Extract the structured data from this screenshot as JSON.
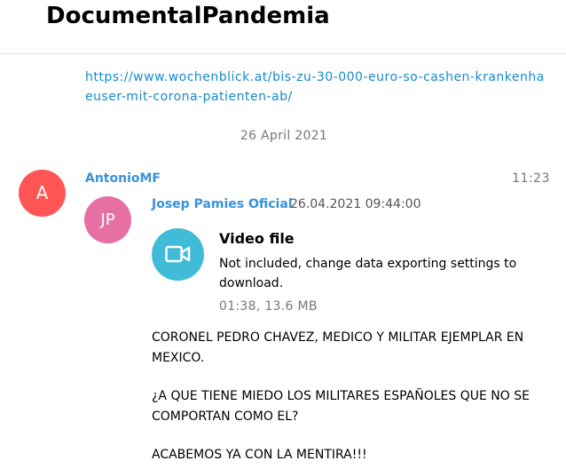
{
  "header": {
    "title": "DocumentalPandemia"
  },
  "message_link": {
    "text": "https://www.wochenblick.at/bis-zu-30-000-euro-so-cashen-krankenhaeuser-mit-corona-patienten-ab/"
  },
  "date_separator": "26 April 2021",
  "message": {
    "avatar_initials": "A",
    "sender": "AntonioMF",
    "time": "11:23",
    "forwarded": {
      "avatar_initials": "JP",
      "from": "Josep Pamies Oficial",
      "date": "26.04.2021 09:44:00"
    },
    "media": {
      "icon": "video-camera-icon",
      "title": "Video file",
      "status": "Not included, change data exporting settings to download.",
      "size": "01:38, 13.6 MB"
    },
    "text_lines": [
      "CORONEL PEDRO CHAVEZ, MEDICO Y MILITAR EJEMPLAR EN",
      "MEXICO.",
      "¿A QUE TIENE MIEDO LOS MILITARES ESPAÑOLES QUE NO SE",
      "COMPORTAN COMO EL?",
      "ACABEMOS YA CON LA MENTIRA!!!"
    ]
  },
  "colors": {
    "link": "#168acd",
    "sender": "#3892db",
    "avatar_a": "#ff5555",
    "avatar_jp": "#e670a3",
    "video_icon_bg": "#40bcd8"
  }
}
